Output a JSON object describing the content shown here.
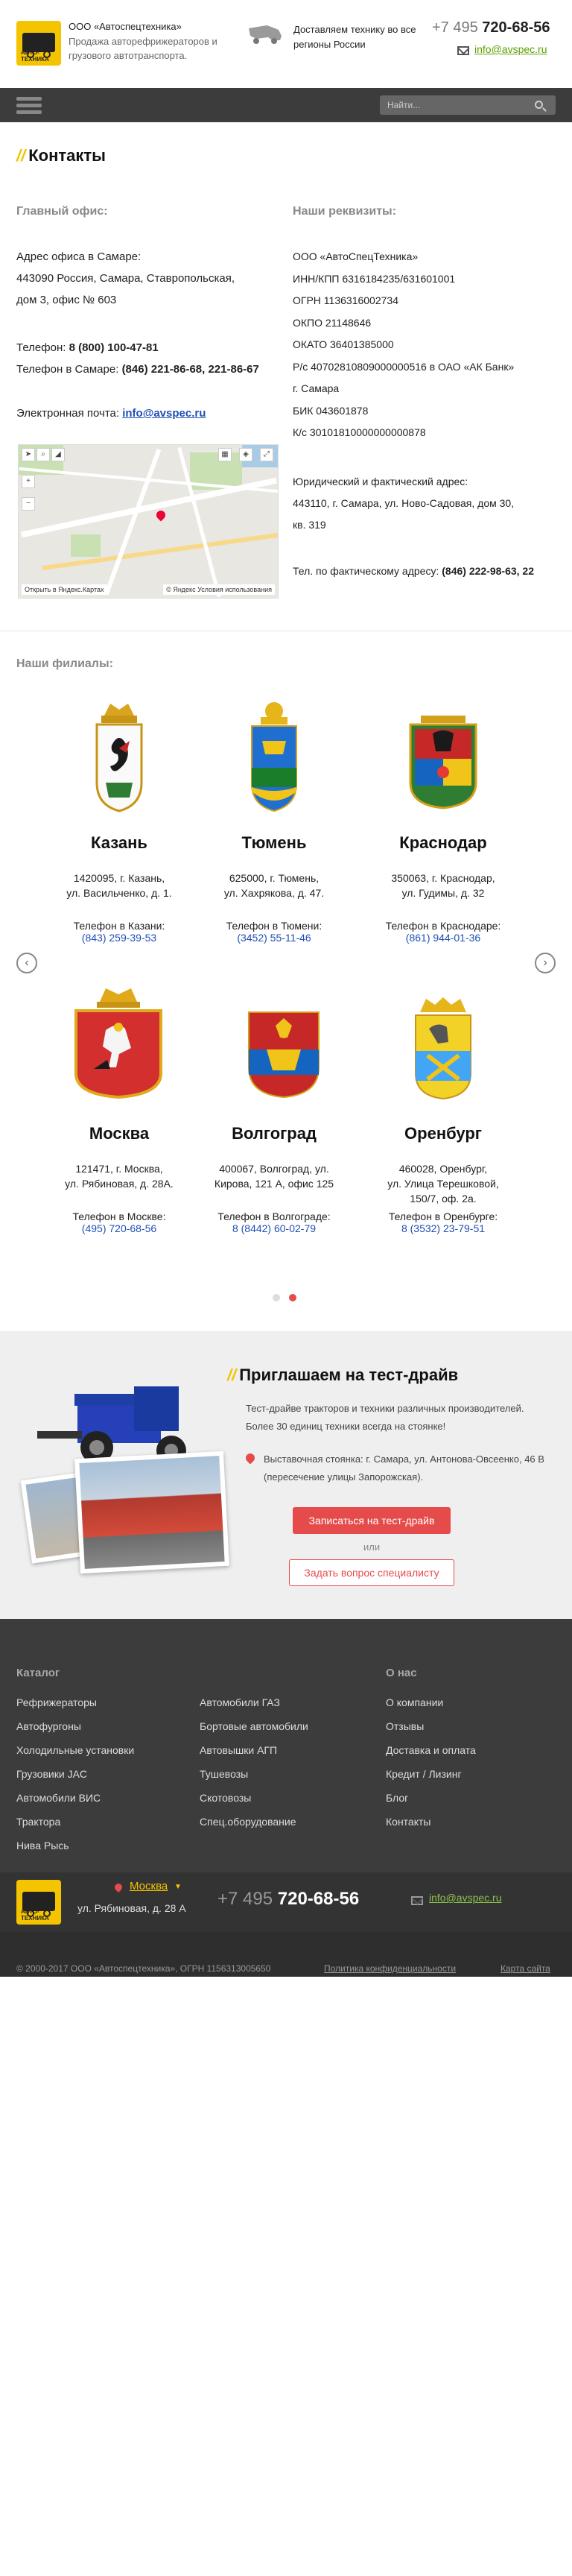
{
  "header": {
    "logo_tag": "АВТО-ТЕХНИКА",
    "company": "ООО «Автоспецтехника»",
    "tagline": "Продажа авторефрижераторов и грузового автотранспорта.",
    "delivery": "Доставляем технику во все регионы России",
    "phone_prefix": "+7 495",
    "phone_number": "720-68-56",
    "email": "info@avspec.ru"
  },
  "nav": {
    "search_placeholder": "Найти..."
  },
  "contacts": {
    "title": "Контакты",
    "main_office_heading": "Главный офис:",
    "address_lines": [
      "Адрес офиса в Самаре:",
      "443090 Россия, Самара, Ставропольская,",
      "дом 3, офис № 603"
    ],
    "phone1_label": "Телефон:",
    "phone1": "8 (800) 100-47-81",
    "phone2_label": "Телефон в Самаре:",
    "phone2": "(846) 221-86-68, 221-86-67",
    "email_label": "Электронная почта:",
    "email": "info@avspec.ru",
    "map_open": "Открыть в Яндекс.Картах",
    "map_copy": "© Яндекс  Условия использования",
    "requisites_heading": "Наши реквизиты:",
    "requisites": [
      "ООО «АвтоСпецТехника»",
      "ИНН/КПП 6316184235/631601001",
      "ОГРН 1136316002734",
      "ОКПО 21148646",
      "ОКАТО 36401385000",
      "Р/с 40702810809000000516 в ОАО «АК Банк»",
      "г. Самара",
      "БИК 043601878",
      "К/с 30101810000000000878"
    ],
    "legal_lines": [
      "Юридический и фактический адрес:",
      "443110, г. Самара, ул. Ново-Садовая, дом 30,",
      "кв. 319"
    ],
    "actual_phone_label": "Тел. по фактическому адресу:",
    "actual_phone": "(846) 222-98-63, 22"
  },
  "branches": {
    "heading": "Наши филиалы:",
    "items": [
      {
        "city": "Казань",
        "addr1": "1420095, г. Казань,",
        "addr2": "ул. Васильченко, д. 1.",
        "addr3": "",
        "label": "Телефон в Казани:",
        "phone": "(843) 259-39-53"
      },
      {
        "city": "Тюмень",
        "addr1": "625000, г. Тюмень,",
        "addr2": "ул. Хахрякова, д. 47.",
        "addr3": "",
        "label": "Телефон в Тюмени:",
        "phone": "(3452) 55-11-46"
      },
      {
        "city": "Краснодар",
        "addr1": "350063, г. Краснодар,",
        "addr2": "ул. Гудимы, д. 32",
        "addr3": "",
        "label": "Телефон в Краснодаре:",
        "phone": "(861) 944-01-36"
      },
      {
        "city": "Москва",
        "addr1": "121471, г. Москва,",
        "addr2": "ул. Рябиновая, д. 28А.",
        "addr3": "",
        "label": "Телефон в Москве:",
        "phone": "(495) 720-68-56"
      },
      {
        "city": "Волгоград",
        "addr1": "400067, Волгоград, ул.",
        "addr2": "Кирова, 121 А, офис 125",
        "addr3": "",
        "label": "Телефон в Волгограде:",
        "phone": "8 (8442) 60-02-79"
      },
      {
        "city": "Оренбург",
        "addr1": "460028, Оренбург,",
        "addr2": "ул. Улица Терешковой,",
        "addr3": "150/7, оф. 2а.",
        "label": "Телефон в Оренбурге:",
        "phone": "8 (3532) 23-79-51"
      }
    ],
    "prev": "‹",
    "next": "›"
  },
  "testdrive": {
    "title": "Приглашаем на тест-драйв",
    "text": "Тест-драйве тракторов и техники различных производителей. Более 30 единиц техники всегда на стоянке!",
    "address": "Выставочная стоянка: г. Самара, ул. Антонова-Овсеенко, 46 В (пересечение улицы Запорожская).",
    "signup": "Записаться на тест-драйв",
    "or": "или",
    "ask": "Задать вопрос специалисту"
  },
  "footer": {
    "catalog_heading": "Каталог",
    "about_heading": "О нас",
    "col1": [
      "Рефрижераторы",
      "Автофургоны",
      "Холодильные установки",
      "Грузовики JAC",
      "Автомобили ВИС",
      "Трактора",
      "Нива Рысь"
    ],
    "col2": [
      "Автомобили ГАЗ",
      "Бортовые автомобили",
      "Автовышки АГП",
      "Тушевозы",
      "Скотовозы",
      "Спец.оборудование"
    ],
    "col3": [
      "О компании",
      "Отзывы",
      "Доставка и оплата",
      "Кредит / Лизинг",
      "Блог",
      "Контакты"
    ],
    "city": "Москва",
    "street": "ул. Рябиновая, д. 28 А",
    "phone_prefix": "+7 495",
    "phone_number": "720-68-56",
    "email": "info@avspec.ru",
    "copyright": "© 2000-2017 ООО «Автоспецтехника», ОГРН 1156313005650",
    "privacy": "Политика конфиденциальности",
    "sitemap": "Карта сайта"
  },
  "colors": {
    "accent": "#f5c400",
    "link": "#1f4fb5",
    "cta": "#e64b4b",
    "dark": "#3c3c3c"
  }
}
